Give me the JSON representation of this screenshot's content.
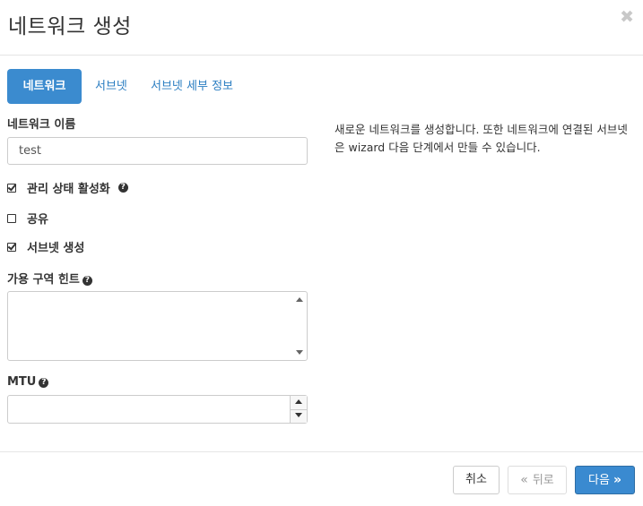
{
  "header": {
    "title": "네트워크 생성",
    "close_symbol": "✖"
  },
  "tabs": [
    {
      "label": "네트워크",
      "active": true
    },
    {
      "label": "서브넷",
      "active": false
    },
    {
      "label": "서브넷 세부 정보",
      "active": false
    }
  ],
  "form": {
    "network_name_label": "네트워크 이름",
    "network_name_value": "test",
    "admin_state_label": "관리 상태 활성화",
    "admin_state_checked": true,
    "shared_label": "공유",
    "shared_checked": false,
    "create_subnet_label": "서브넷 생성",
    "create_subnet_checked": true,
    "az_hint_label": "가용 구역 힌트",
    "az_hint_value": "",
    "mtu_label": "MTU",
    "mtu_value": ""
  },
  "help": {
    "text": "새로운 네트워크를 생성합니다. 또한 네트워크에 연결된 서브넷은 wizard 다음 단계에서 만들 수 있습니다."
  },
  "footer": {
    "cancel_label": "취소",
    "back_label": "뒤로",
    "next_label": "다음"
  },
  "colors": {
    "primary": "#3a8ad0",
    "link": "#2a7dc1"
  }
}
